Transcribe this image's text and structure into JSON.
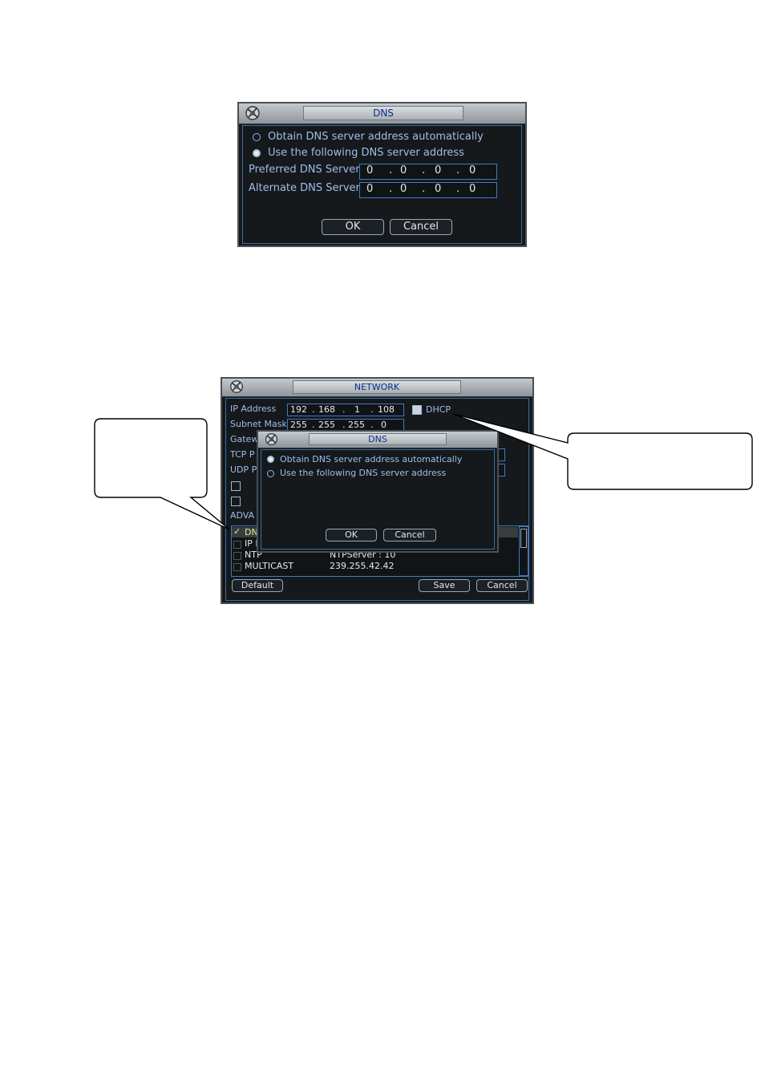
{
  "dns_window_1": {
    "title": "DNS",
    "radio_auto_label": "Obtain DNS server address automatically",
    "radio_auto_checked": false,
    "radio_manual_label": "Use the following DNS server address",
    "radio_manual_checked": true,
    "preferred_label": "Preferred DNS Server",
    "preferred_octets": [
      "0",
      "0",
      "0",
      "0"
    ],
    "alternate_label": "Alternate DNS Server",
    "alternate_octets": [
      "0",
      "0",
      "0",
      "0"
    ],
    "ok_label": "OK",
    "cancel_label": "Cancel"
  },
  "network_window": {
    "title": "NETWORK",
    "ip_label": "IP Address",
    "ip_octets": [
      "192",
      "168",
      "1",
      "108"
    ],
    "dhcp_label": "DHCP",
    "subnet_label": "Subnet Mask",
    "subnet_octets": [
      "255",
      "255",
      "255",
      "0"
    ],
    "gateway_label": "Gatew",
    "tcp_label": "TCP P",
    "udp_label": "UDP P",
    "advanced_label": "ADVA",
    "list_rows": [
      {
        "name": "DN",
        "value": ""
      },
      {
        "name": "IP F",
        "value": ""
      },
      {
        "name": "NTP",
        "value": "NTPServer : 10"
      },
      {
        "name": "MULTICAST",
        "value": "239.255.42.42"
      }
    ],
    "default_label": "Default",
    "save_label": "Save",
    "cancel_label": "Cancel"
  },
  "dns_window_2": {
    "title": "DNS",
    "radio_auto_label": "Obtain DNS server address automatically",
    "radio_auto_checked": true,
    "radio_manual_label": "Use the following DNS server address",
    "radio_manual_checked": false,
    "ok_label": "OK",
    "cancel_label": "Cancel"
  },
  "colors": {
    "window_bg": "#15191c",
    "accent_blue": "#3f7bbd",
    "label_blue": "#9fbde9",
    "title_text": "#0a2f8c"
  }
}
